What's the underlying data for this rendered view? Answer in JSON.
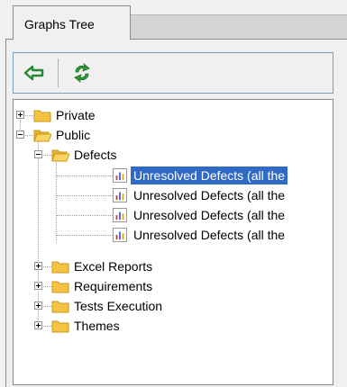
{
  "tab": {
    "label": "Graphs Tree"
  },
  "toolbar": {
    "back_icon": "arrow-left-icon",
    "refresh_icon": "refresh-icon"
  },
  "tree": {
    "private": "Private",
    "public": "Public",
    "defects": "Defects",
    "graphs": [
      "Unresolved Defects (all the",
      "Unresolved Defects (all the",
      "Unresolved Defects (all the",
      "Unresolved Defects (all the"
    ],
    "excel_reports": "Excel Reports",
    "requirements": "Requirements",
    "tests_execution": "Tests Execution",
    "themes": "Themes"
  },
  "colors": {
    "selection": "#3169c6",
    "folder": "#f5c242",
    "toolbar_icon": "#2e9b3a"
  }
}
